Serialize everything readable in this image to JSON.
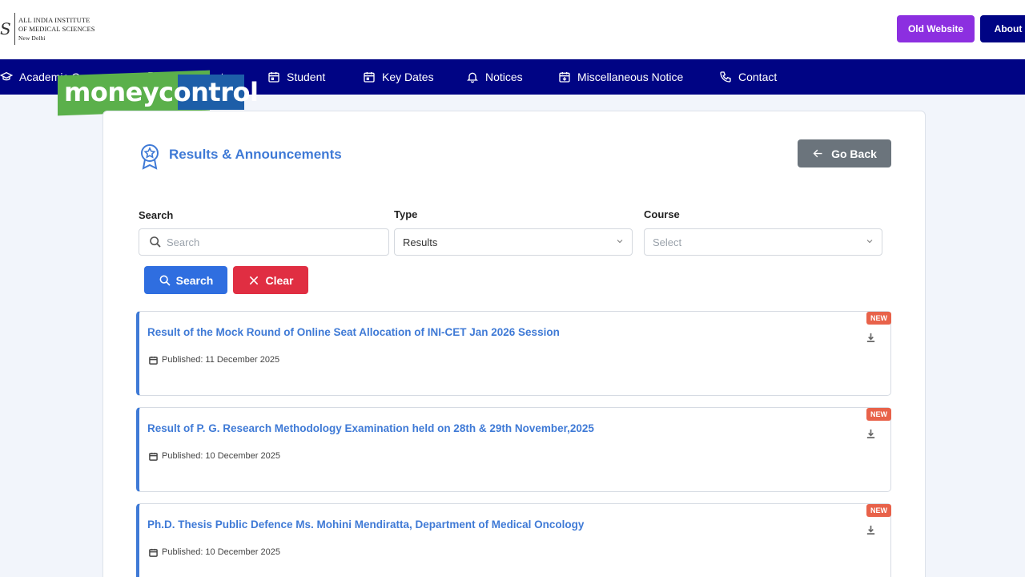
{
  "header": {
    "logo_line1": "ALL INDIA INSTITUTE",
    "logo_line2": "OF MEDICAL SCIENCES",
    "logo_line3": "New Delhi",
    "old_website_label": "Old Website",
    "about_label": "About"
  },
  "nav": {
    "items": [
      {
        "label": "Academic Courses",
        "icon": "graduation-cap-icon"
      },
      {
        "label": "Recruitments",
        "icon": "briefcase-icon"
      },
      {
        "label": "Student",
        "icon": "calendar-icon"
      },
      {
        "label": "Key Dates",
        "icon": "calendar-icon"
      },
      {
        "label": "Notices",
        "icon": "bell-icon"
      },
      {
        "label": "Miscellaneous Notice",
        "icon": "calendar-download-icon"
      },
      {
        "label": "Contact",
        "icon": "phone-icon"
      }
    ]
  },
  "watermark": {
    "text": "moneycontrol"
  },
  "page": {
    "title": "Results & Announcements",
    "go_back_label": "Go Back"
  },
  "filters": {
    "search_label": "Search",
    "search_placeholder": "Search",
    "type_label": "Type",
    "type_value": "Results",
    "course_label": "Course",
    "course_placeholder": "Select",
    "search_button": "Search",
    "clear_button": "Clear"
  },
  "results": [
    {
      "title": "Result of the Mock Round of Online Seat Allocation of INI-CET Jan 2026 Session",
      "published": "Published: 11 December 2025",
      "badge": "NEW"
    },
    {
      "title": "Result of P. G. Research Methodology Examination held on 28th & 29th November,2025",
      "published": "Published: 10 December 2025",
      "badge": "NEW"
    },
    {
      "title": "Ph.D. Thesis Public Defence Ms. Mohini Mendiratta, Department of Medical Oncology",
      "published": "Published: 10 December 2025",
      "badge": "NEW"
    }
  ],
  "colors": {
    "nav_bg": "#000484",
    "accent_blue": "#3f7ad6",
    "old_website_bg": "#8c2fe0",
    "search_btn": "#2f6ee0",
    "clear_btn": "#e02e42",
    "badge_new": "#e8624a"
  }
}
